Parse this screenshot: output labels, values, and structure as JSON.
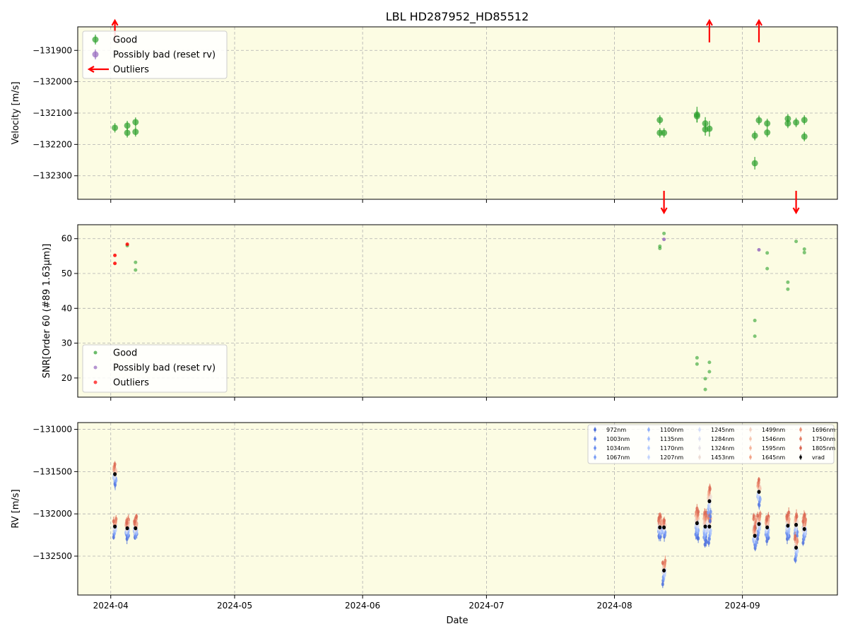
{
  "title": "LBL HD287952_HD85512",
  "xlabel": "Date",
  "x_ticks": [
    "2024-04",
    "2024-05",
    "2024-06",
    "2024-07",
    "2024-08",
    "2024-09"
  ],
  "colors": {
    "background": "#fcfce3",
    "good": "#2ca02c",
    "possibly_bad": "#9467bd",
    "outliers": "#ff0000",
    "vrad": "#000000"
  },
  "chart_data": [
    {
      "type": "scatter",
      "panel": "velocity",
      "ylabel": "Velocity [m/s]",
      "xlim": [
        "2024-03-24",
        "2024-09-24"
      ],
      "ylim": [
        -132375,
        -131825
      ],
      "y_ticks": [
        -131900,
        -132000,
        -132100,
        -132200,
        -132300
      ],
      "y_tick_labels": [
        "−131900",
        "−132000",
        "−132100",
        "−132200",
        "−132300"
      ],
      "grid": true,
      "legend_position": "top-left",
      "legend": [
        "Good",
        "Possibly bad (reset rv)",
        "Outliers"
      ],
      "series": [
        {
          "name": "Good",
          "points": [
            {
              "x": "2024-04-02",
              "y": -132147,
              "err": 15
            },
            {
              "x": "2024-04-05",
              "y": -132140,
              "err": 15
            },
            {
              "x": "2024-04-05",
              "y": -132163,
              "err": 15
            },
            {
              "x": "2024-04-07",
              "y": -132129,
              "err": 15
            },
            {
              "x": "2024-04-07",
              "y": -132160,
              "err": 15
            },
            {
              "x": "2024-08-12",
              "y": -132122,
              "err": 15
            },
            {
              "x": "2024-08-12",
              "y": -132163,
              "err": 15
            },
            {
              "x": "2024-08-13",
              "y": -132163,
              "err": 15
            },
            {
              "x": "2024-08-21",
              "y": -132105,
              "err": 25
            },
            {
              "x": "2024-08-21",
              "y": -132110,
              "err": 20
            },
            {
              "x": "2024-08-23",
              "y": -132133,
              "err": 20
            },
            {
              "x": "2024-08-23",
              "y": -132152,
              "err": 20
            },
            {
              "x": "2024-08-24",
              "y": -132150,
              "err": 25
            },
            {
              "x": "2024-09-04",
              "y": -132172,
              "err": 15
            },
            {
              "x": "2024-09-04",
              "y": -132260,
              "err": 20
            },
            {
              "x": "2024-09-05",
              "y": -132123,
              "err": 15
            },
            {
              "x": "2024-09-07",
              "y": -132133,
              "err": 15
            },
            {
              "x": "2024-09-07",
              "y": -132162,
              "err": 15
            },
            {
              "x": "2024-09-12",
              "y": -132118,
              "err": 15
            },
            {
              "x": "2024-09-12",
              "y": -132133,
              "err": 15
            },
            {
              "x": "2024-09-14",
              "y": -132130,
              "err": 15
            },
            {
              "x": "2024-09-16",
              "y": -132122,
              "err": 15
            },
            {
              "x": "2024-09-16",
              "y": -132175,
              "err": 15
            }
          ]
        },
        {
          "name": "Outliers",
          "arrows": [
            {
              "x": "2024-04-02",
              "direction": "up"
            },
            {
              "x": "2024-08-24",
              "direction": "up"
            },
            {
              "x": "2024-09-05",
              "direction": "up"
            },
            {
              "x": "2024-08-13",
              "direction": "down"
            },
            {
              "x": "2024-09-14",
              "direction": "down"
            }
          ]
        }
      ]
    },
    {
      "type": "scatter",
      "panel": "snr",
      "ylabel": "SNR[Order 60 (#89 1.63μm)]",
      "xlim": [
        "2024-03-24",
        "2024-09-24"
      ],
      "ylim": [
        14.5,
        64
      ],
      "y_ticks": [
        20,
        30,
        40,
        50,
        60
      ],
      "grid": true,
      "legend_position": "bottom-left",
      "legend": [
        "Good",
        "Possibly bad (reset rv)",
        "Outliers"
      ],
      "series": [
        {
          "name": "Good",
          "points": [
            {
              "x": "2024-04-05",
              "y": 58.0
            },
            {
              "x": "2024-04-07",
              "y": 53.2
            },
            {
              "x": "2024-04-07",
              "y": 51.0
            },
            {
              "x": "2024-08-12",
              "y": 57.2
            },
            {
              "x": "2024-08-12",
              "y": 57.8
            },
            {
              "x": "2024-08-13",
              "y": 61.5
            },
            {
              "x": "2024-08-21",
              "y": 25.8
            },
            {
              "x": "2024-08-21",
              "y": 24.0
            },
            {
              "x": "2024-08-23",
              "y": 19.8
            },
            {
              "x": "2024-08-23",
              "y": 16.7
            },
            {
              "x": "2024-08-24",
              "y": 24.5
            },
            {
              "x": "2024-08-24",
              "y": 21.8
            },
            {
              "x": "2024-09-04",
              "y": 36.5
            },
            {
              "x": "2024-09-04",
              "y": 32.0
            },
            {
              "x": "2024-09-07",
              "y": 55.9
            },
            {
              "x": "2024-09-07",
              "y": 51.4
            },
            {
              "x": "2024-09-12",
              "y": 47.5
            },
            {
              "x": "2024-09-12",
              "y": 45.5
            },
            {
              "x": "2024-09-14",
              "y": 59.2
            },
            {
              "x": "2024-09-16",
              "y": 57.0
            },
            {
              "x": "2024-09-16",
              "y": 56.0
            }
          ]
        },
        {
          "name": "Possibly bad (reset rv)",
          "points": [
            {
              "x": "2024-08-13",
              "y": 59.8
            },
            {
              "x": "2024-09-05",
              "y": 56.8
            }
          ]
        },
        {
          "name": "Outliers",
          "points": [
            {
              "x": "2024-04-02",
              "y": 55.2
            },
            {
              "x": "2024-04-02",
              "y": 52.9
            },
            {
              "x": "2024-04-05",
              "y": 58.4
            }
          ]
        }
      ]
    },
    {
      "type": "scatter",
      "panel": "rv_per_band",
      "ylabel": "RV [m/s]",
      "xlim": [
        "2024-03-24",
        "2024-09-24"
      ],
      "ylim": [
        -132960,
        -130920
      ],
      "y_ticks": [
        -131000,
        -131500,
        -132000,
        -132500
      ],
      "y_tick_labels": [
        "−131000",
        "−131500",
        "−132000",
        "−132500"
      ],
      "grid": true,
      "legend_position": "top-right",
      "legend": [
        "972nm",
        "1003nm",
        "1034nm",
        "1067nm",
        "1100nm",
        "1135nm",
        "1170nm",
        "1207nm",
        "1245nm",
        "1284nm",
        "1324nm",
        "1453nm",
        "1499nm",
        "1546nm",
        "1595nm",
        "1645nm",
        "1696nm",
        "1750nm",
        "1805nm",
        "vrad"
      ],
      "band_colors": [
        "#4a6bd9",
        "#5a7de5",
        "#6b8eee",
        "#7c9ff5",
        "#8eaefa",
        "#a0bcfd",
        "#b2c9fe",
        "#c3d4fd",
        "#d2dcf9",
        "#dde1f2",
        "#e6e2e8",
        "#eddcd5",
        "#f3d2c3",
        "#f5c5b0",
        "#f5b59c",
        "#f2a488",
        "#ec9175",
        "#e47d64",
        "#d96853",
        "#000000"
      ],
      "band_offsets": [
        -120,
        -100,
        -80,
        -65,
        -50,
        -40,
        -30,
        -20,
        -10,
        0,
        10,
        20,
        30,
        40,
        50,
        60,
        70,
        80,
        90,
        0
      ],
      "epochs": [
        {
          "x": "2024-04-02",
          "vrad": -132150,
          "spread": 90
        },
        {
          "x": "2024-04-02",
          "vrad": -131530,
          "spread": 110
        },
        {
          "x": "2024-04-05",
          "vrad": -132150,
          "spread": 90
        },
        {
          "x": "2024-04-05",
          "vrad": -132170,
          "spread": 90
        },
        {
          "x": "2024-04-07",
          "vrad": -132130,
          "spread": 90
        },
        {
          "x": "2024-04-07",
          "vrad": -132170,
          "spread": 90
        },
        {
          "x": "2024-08-12",
          "vrad": -132120,
          "spread": 110
        },
        {
          "x": "2024-08-12",
          "vrad": -132160,
          "spread": 100
        },
        {
          "x": "2024-08-13",
          "vrad": -132160,
          "spread": 90
        },
        {
          "x": "2024-08-13",
          "vrad": -132670,
          "spread": 120
        },
        {
          "x": "2024-08-21",
          "vrad": -132100,
          "spread": 160
        },
        {
          "x": "2024-08-21",
          "vrad": -132110,
          "spread": 150
        },
        {
          "x": "2024-08-23",
          "vrad": -132140,
          "spread": 170
        },
        {
          "x": "2024-08-23",
          "vrad": -132150,
          "spread": 160
        },
        {
          "x": "2024-08-24",
          "vrad": -132150,
          "spread": 160
        },
        {
          "x": "2024-08-24",
          "vrad": -131850,
          "spread": 180
        },
        {
          "x": "2024-09-04",
          "vrad": -132170,
          "spread": 140
        },
        {
          "x": "2024-09-04",
          "vrad": -132260,
          "spread": 120
        },
        {
          "x": "2024-09-05",
          "vrad": -132120,
          "spread": 130
        },
        {
          "x": "2024-09-05",
          "vrad": -131740,
          "spread": 140
        },
        {
          "x": "2024-09-07",
          "vrad": -132140,
          "spread": 120
        },
        {
          "x": "2024-09-07",
          "vrad": -132160,
          "spread": 120
        },
        {
          "x": "2024-09-12",
          "vrad": -132120,
          "spread": 130
        },
        {
          "x": "2024-09-12",
          "vrad": -132140,
          "spread": 130
        },
        {
          "x": "2024-09-14",
          "vrad": -132130,
          "spread": 130
        },
        {
          "x": "2024-09-14",
          "vrad": -132400,
          "spread": 130
        },
        {
          "x": "2024-09-16",
          "vrad": -132120,
          "spread": 120
        },
        {
          "x": "2024-09-16",
          "vrad": -132180,
          "spread": 120
        }
      ]
    }
  ]
}
